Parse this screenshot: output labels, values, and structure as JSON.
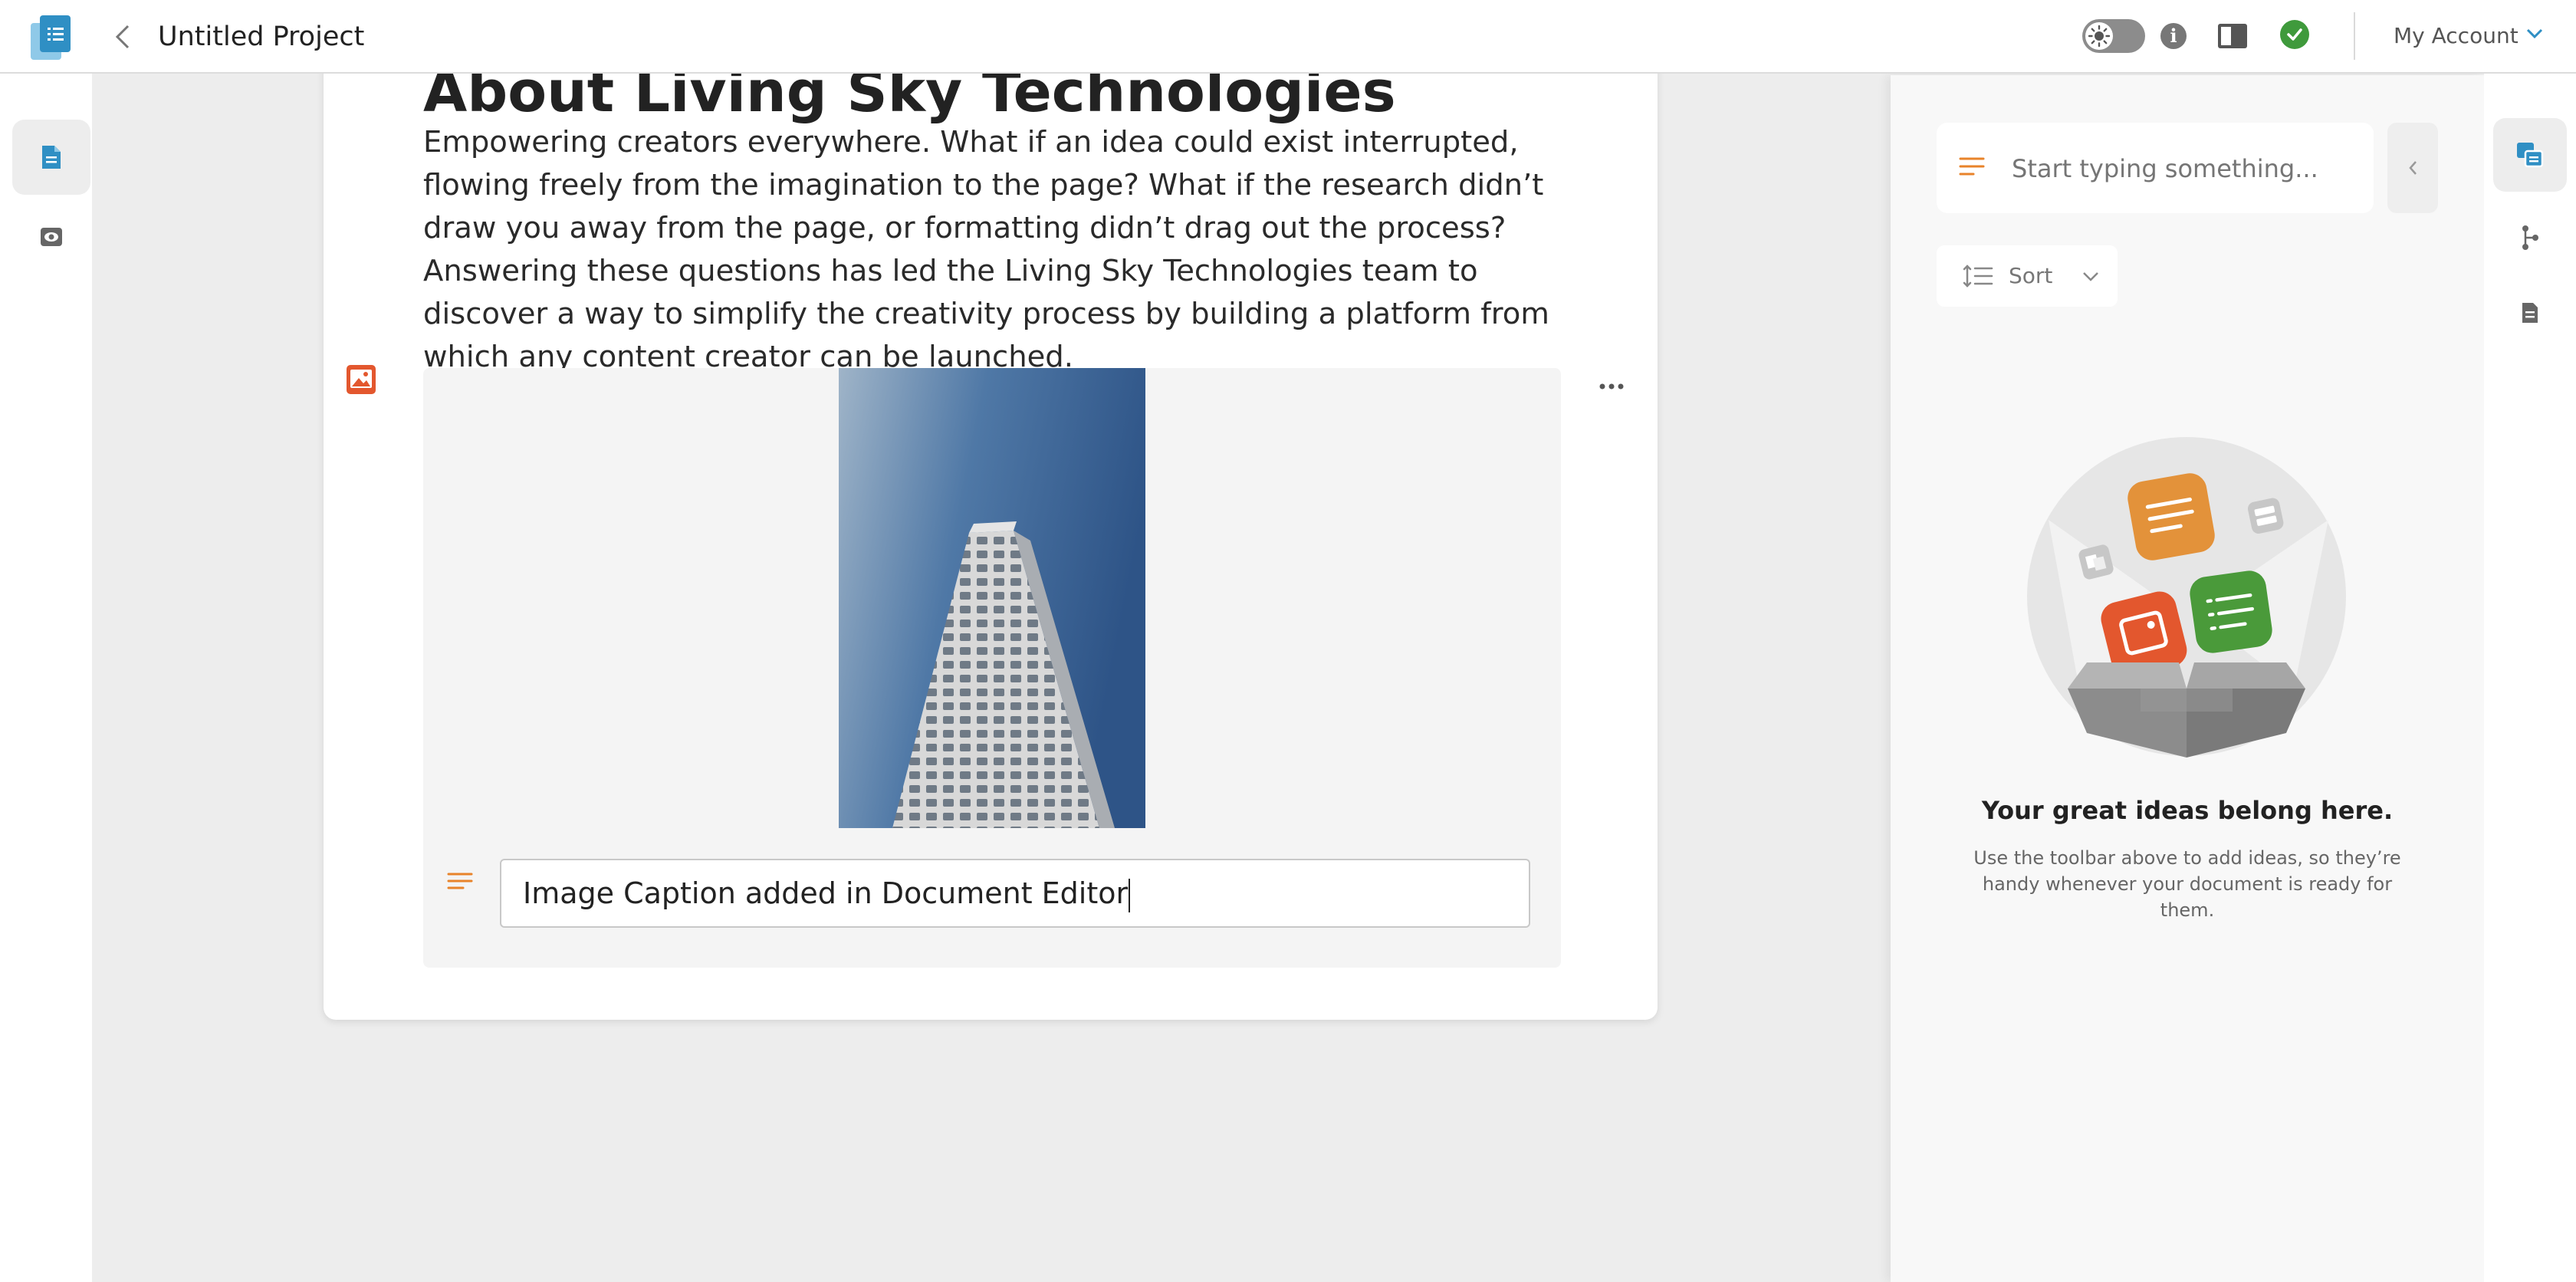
{
  "header": {
    "project_title": "Untitled Project",
    "account_label": "My Account"
  },
  "document": {
    "heading": "About Living Sky Technologies",
    "paragraph": "Empowering creators everywhere. What if an idea could exist interrupted, flowing freely from the imagination to the page? What if the research didn’t draw you away from the page, or formatting didn’t drag out the process? Answering these questions has led the Living Sky Technologies team to discover a way to simplify the creativity process by building a platform from which any content creator can be launched.",
    "image_caption": "Image Caption added in Document Editor"
  },
  "ideas_panel": {
    "search_placeholder": "Start typing something...",
    "sort_label": "Sort",
    "empty_title": "Your great ideas belong here.",
    "empty_subtitle": "Use the toolbar above to add ideas, so they’re handy whenever your document is ready for them."
  },
  "colors": {
    "accent_orange": "#e8832a",
    "brand_blue": "#2f8fc4",
    "status_green": "#3f9a3c",
    "image_red": "#e3572e"
  },
  "icons": {
    "left_rail": [
      "document-icon",
      "preview-eye-icon"
    ],
    "right_rail": [
      "ideas-icon",
      "branch-icon",
      "notes-icon"
    ]
  }
}
